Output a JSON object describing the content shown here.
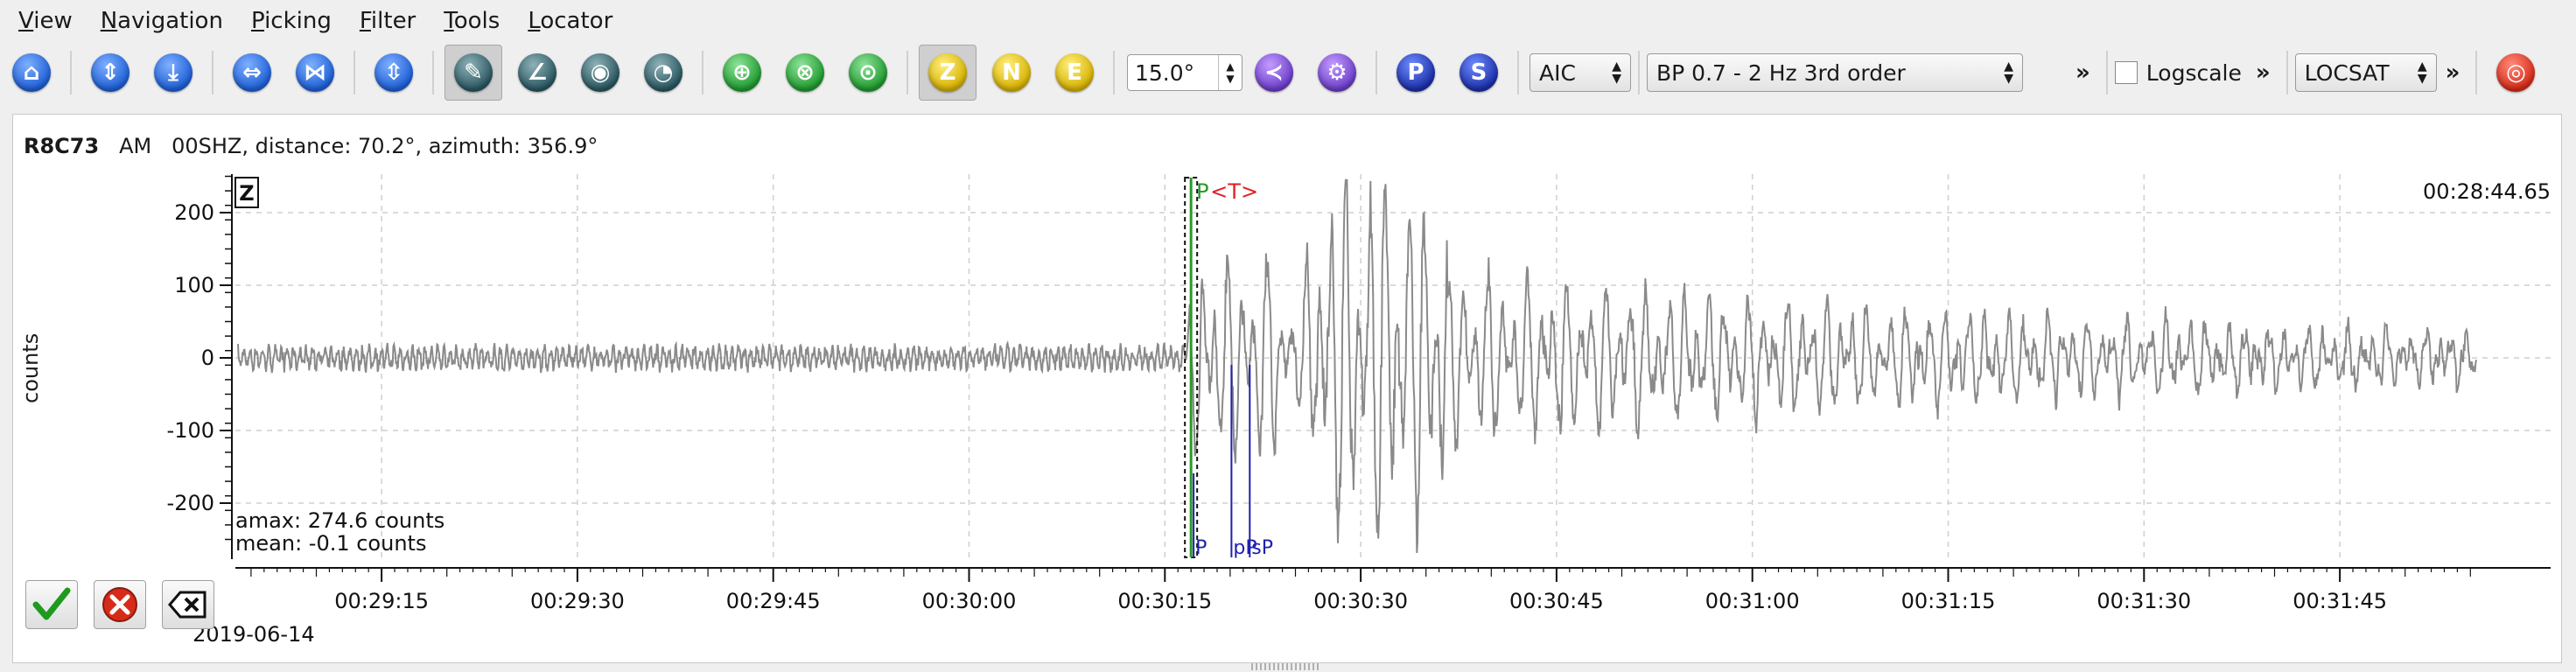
{
  "menu": {
    "items": [
      {
        "label": "View",
        "u": "V",
        "rest": "iew"
      },
      {
        "label": "Navigation",
        "u": "N",
        "rest": "avigation"
      },
      {
        "label": "Picking",
        "u": "P",
        "rest": "icking"
      },
      {
        "label": "Filter",
        "u": "F",
        "rest": "ilter"
      },
      {
        "label": "Tools",
        "u": "T",
        "rest": "ools"
      },
      {
        "label": "Locator",
        "u": "L",
        "rest": "ocator"
      }
    ]
  },
  "toolbar": {
    "component_z": "Z",
    "component_n": "N",
    "component_e": "E",
    "slowness_value": "15.0°",
    "picker_select": "AIC",
    "filter_select": "BP 0.7 - 2 Hz  3rd order",
    "logscale_label": "Logscale",
    "locator_select": "LOCSAT",
    "chevron": "»",
    "p_label": "P",
    "s_label": "S"
  },
  "trace": {
    "station": "R8C73",
    "network": "AM",
    "channel_info": "00SHZ, distance: 70.2°, azimuth: 356.9°",
    "component_box": "Z",
    "time_right": "00:28:44.65",
    "ylabel": "counts",
    "amax": "amax: 274.6 counts",
    "mean": "mean: -0.1 counts",
    "date": "2019-06-14",
    "y_ticks": [
      "200",
      "100",
      "0",
      "-100",
      "-200"
    ],
    "y_values": [
      200,
      100,
      0,
      -100,
      -200
    ],
    "x_ticks": [
      "00:29:15",
      "00:29:30",
      "00:29:45",
      "00:30:00",
      "00:30:15",
      "00:30:30",
      "00:30:45",
      "00:31:00",
      "00:31:15",
      "00:31:30",
      "00:31:45"
    ],
    "x_seconds": [
      15,
      30,
      45,
      60,
      75,
      90,
      105,
      120,
      135,
      150,
      165
    ],
    "pick_label": "P",
    "theoretical_label": "<T>",
    "phase_labels": [
      {
        "text": "P",
        "t": 77.2
      },
      {
        "text": "pP",
        "t": 80.1
      },
      {
        "text": "sP",
        "t": 81.5
      }
    ],
    "pick_time": 76.6,
    "colors": {
      "trace": "#8a8a8a",
      "pick": "#2a9a2a",
      "theoretical": "#e02020",
      "phase": "#2020b0"
    }
  }
}
